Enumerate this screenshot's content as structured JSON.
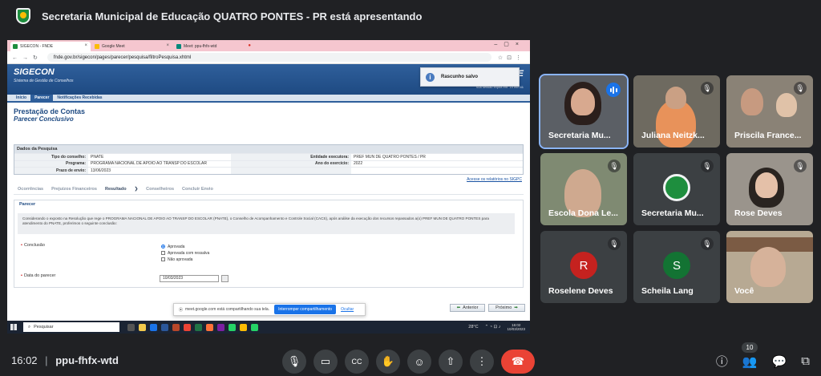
{
  "meet": {
    "presenting_banner": "Secretaria Municipal de Educação QUATRO PONTES - PR está apresentando",
    "clock": "16:02",
    "separator": "|",
    "meeting_code": "ppu-fhfx-wtd",
    "participant_count": "10",
    "participants": [
      {
        "name": "Secretaria Mu...",
        "speaking": true
      },
      {
        "name": "Juliana Neitzk...",
        "muted": true
      },
      {
        "name": "Priscila France...",
        "muted": true
      },
      {
        "name": "Escola Dona Le...",
        "muted": true
      },
      {
        "name": "Secretaria Mu...",
        "muted": true
      },
      {
        "name": "Rose Deves",
        "muted": true
      },
      {
        "name": "Roselene Deves",
        "initial": "R",
        "avatar_color": "#c5221f",
        "muted": true
      },
      {
        "name": "Scheila Lang",
        "initial": "S",
        "avatar_color": "#137333",
        "muted": true
      },
      {
        "name": "Você"
      }
    ],
    "controls": [
      "mic-icon",
      "camera-icon",
      "captions-icon",
      "raise-hand-icon",
      "emoji-icon",
      "present-icon",
      "more-icon",
      "end-call-icon"
    ],
    "end_call_color": "#ea4335"
  },
  "browser": {
    "tabs": [
      "SIGECON - FNDE",
      "Google Meet",
      "Meet: ppu-fhfx-wtd"
    ],
    "url": "fnde.gov.br/sigecon/pages/parecer/pesquisa/filtroPesquisa.xhtml"
  },
  "sigecon": {
    "logo": "SIGECON",
    "subtitle": "Sistema de Gestão de Conselhos",
    "brand": "FNDE",
    "session_text": "Sua sessão expira em: 19 min 41",
    "toast": "Rascunho salvo",
    "menu": [
      "Início",
      "Parecer",
      "Notificações Recebidas"
    ],
    "page_title": "Prestação de Contas",
    "page_subtitle": "Parecer Conclusivo",
    "search_panel": {
      "header": "Dados da Pesquisa",
      "rows": [
        {
          "l1": "Tipo do conselho:",
          "v1": "PNATE",
          "l2": "Entidade executora:",
          "v2": "PREF MUN DE QUATRO PONTES / PR"
        },
        {
          "l1": "Programa:",
          "v1": "PROGRAMA NACIONAL DE APOIO AO TRANSP DO ESCOLAR",
          "l2": "Ano do exercício:",
          "v2": "2022"
        },
        {
          "l1": "Prazo de envio:",
          "v1": "13/06/2023",
          "l2": "",
          "v2": ""
        }
      ]
    },
    "siope_link": "Acesse os relatórios no SIGPC",
    "steps": [
      "Ocorrências",
      "Prejuízos Financeiros",
      "Resultado",
      "Conselheiros",
      "Concluir Envio"
    ],
    "parecer": {
      "legend": "Parecer",
      "text": "Considerando o exposto na Resolução que rege o PROGRAMA NACIONAL DE APOIO AO TRANSP DO ESCOLAR (PNATE), o Conselho de Acompanhamento e Controle Social (CACS), após análise da execução dos recursos repassados a(o) PREF MUN DE QUATRO PONTES para atendimento do PNATE, proferimos o seguinte conclusão:",
      "conclusion_label": "Conclusão",
      "options": [
        "Aprovada",
        "Aprovada com ressalva",
        "Não aprovada"
      ],
      "selected": "Aprovada",
      "date_label": "Data do parecer",
      "date_value": "10/03/2023"
    },
    "share_notice": "meet.google.com está compartilhando sua tela.",
    "stop_sharing": "Interromper compartilhamento",
    "hide": "Ocultar",
    "prev": "Anterior",
    "next": "Próximo"
  },
  "taskbar": {
    "search_placeholder": "Pesquisar",
    "weather": "28°C",
    "time": "16:02",
    "date": "10/03/2023"
  }
}
